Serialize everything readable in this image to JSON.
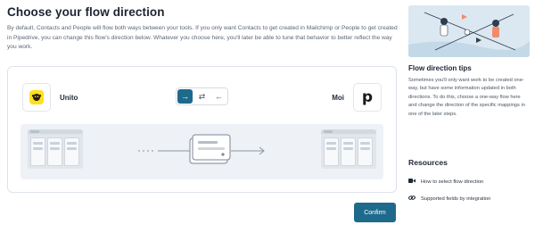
{
  "main": {
    "title": "Choose your flow direction",
    "description": "By default, Contacts and People will flow both ways between your tools. If you only want Contacts to get created in Mailchimp or People to get created in Pipedrive, you can change this flow's direction below. Whatever you choose here, you'll later be able to tune that behavior to better reflect the way you work."
  },
  "tools": {
    "left_name": "Unito",
    "right_name": "Moi",
    "right_logo_letter": "p"
  },
  "direction": {
    "options": [
      {
        "icon": "arrow-right-icon",
        "glyph": "→",
        "active": true
      },
      {
        "icon": "arrow-both-icon",
        "glyph": "⇄",
        "active": false
      },
      {
        "icon": "arrow-left-icon",
        "glyph": "←",
        "active": false
      }
    ]
  },
  "confirm_label": "Confirm",
  "sidebar": {
    "tips_title": "Flow direction tips",
    "tips_text": "Sometimes you'll only want work to be created one-way, but have some information updated in both directions. To do this, choose a one-way flow here and change the direction of the specific mappings in one of the later steps.",
    "resources_title": "Resources",
    "links": [
      {
        "icon": "video-icon",
        "label": "How to select flow direction"
      },
      {
        "icon": "link-icon",
        "label": "Supported fields by integration"
      }
    ]
  },
  "colors": {
    "accent": "#1e6a8d",
    "mailchimp_yellow": "#ffe01b"
  }
}
